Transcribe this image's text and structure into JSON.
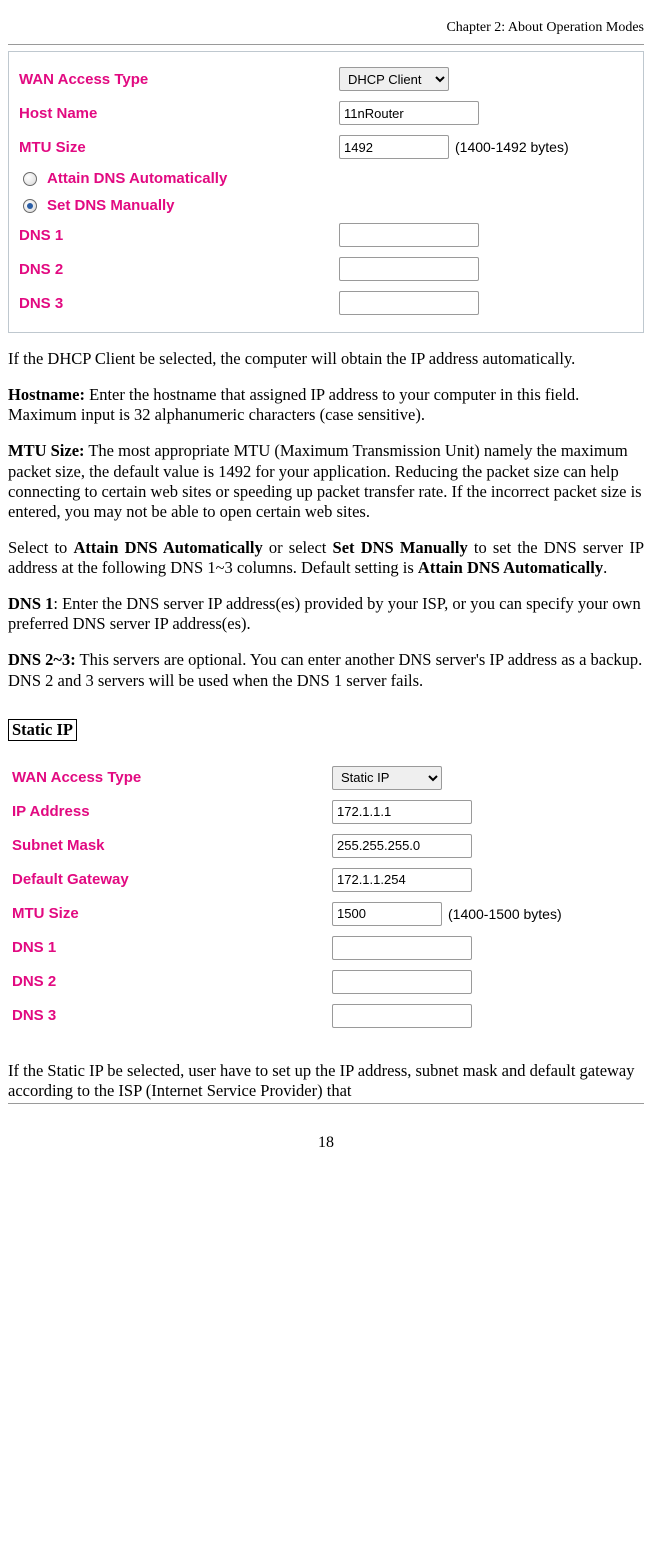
{
  "header": {
    "chapter": "Chapter 2: About Operation Modes"
  },
  "form_dhcp": {
    "wan_access_type": {
      "label": "WAN Access Type",
      "value": "DHCP Client"
    },
    "host_name": {
      "label": "Host Name",
      "value": "11nRouter"
    },
    "mtu_size": {
      "label": "MTU Size",
      "value": "1492",
      "hint": "(1400-1492 bytes)"
    },
    "radio_auto": {
      "label": "Attain DNS Automatically"
    },
    "radio_manual": {
      "label": "Set DNS Manually"
    },
    "dns1": {
      "label": "DNS 1",
      "value": ""
    },
    "dns2": {
      "label": "DNS 2",
      "value": ""
    },
    "dns3": {
      "label": "DNS 3",
      "value": ""
    }
  },
  "para": {
    "dhcp_intro": "If the DHCP Client be selected, the computer will obtain the IP address automatically.",
    "hostname_label": "Hostname:",
    "hostname_text": " Enter the hostname that assigned IP address to your computer in this field. Maximum input is 32 alphanumeric characters (case sensitive).",
    "mtu_label": "MTU Size:",
    "mtu_text": " The most appropriate MTU (Maximum Transmission Unit) namely the maximum packet size, the default value is 1492 for your application. Reducing the packet size can help connecting to certain web sites or speeding up packet transfer rate. If the incorrect packet size is entered, you may not be able to open certain web sites.",
    "dns_select_pre": "Select to ",
    "dns_select_b1": "Attain DNS Automatically",
    "dns_select_mid": " or select ",
    "dns_select_b2": "Set DNS Manually",
    "dns_select_post1": " to set the DNS server IP address at the following DNS 1~3 columns. Default setting is ",
    "dns_select_b3": "Attain DNS Automatically",
    "dns_select_post2": ".",
    "dns1_label": "DNS 1",
    "dns1_text": ": Enter the DNS server IP address(es) provided by your ISP, or you can specify your own preferred DNS server IP address(es).",
    "dns23_label": "DNS 2~3:",
    "dns23_text": " This servers are optional. You can enter another DNS server's IP address as a backup. DNS 2 and 3 servers will be used when the DNS 1 server fails.",
    "static_ip_tag": "Static IP",
    "static_intro": "If the Static IP be selected, user have to set up the IP address, subnet mask and default gateway according to the ISP (Internet Service Provider) that"
  },
  "form_static": {
    "wan_access_type": {
      "label": "WAN Access Type",
      "value": "Static IP"
    },
    "ip_address": {
      "label": "IP Address",
      "value": "172.1.1.1"
    },
    "subnet_mask": {
      "label": "Subnet Mask",
      "value": "255.255.255.0"
    },
    "default_gateway": {
      "label": "Default Gateway",
      "value": "172.1.1.254"
    },
    "mtu_size": {
      "label": "MTU Size",
      "value": "1500",
      "hint": "(1400-1500 bytes)"
    },
    "dns1": {
      "label": "DNS 1",
      "value": ""
    },
    "dns2": {
      "label": "DNS 2",
      "value": ""
    },
    "dns3": {
      "label": "DNS 3",
      "value": ""
    }
  },
  "page_number": "18"
}
